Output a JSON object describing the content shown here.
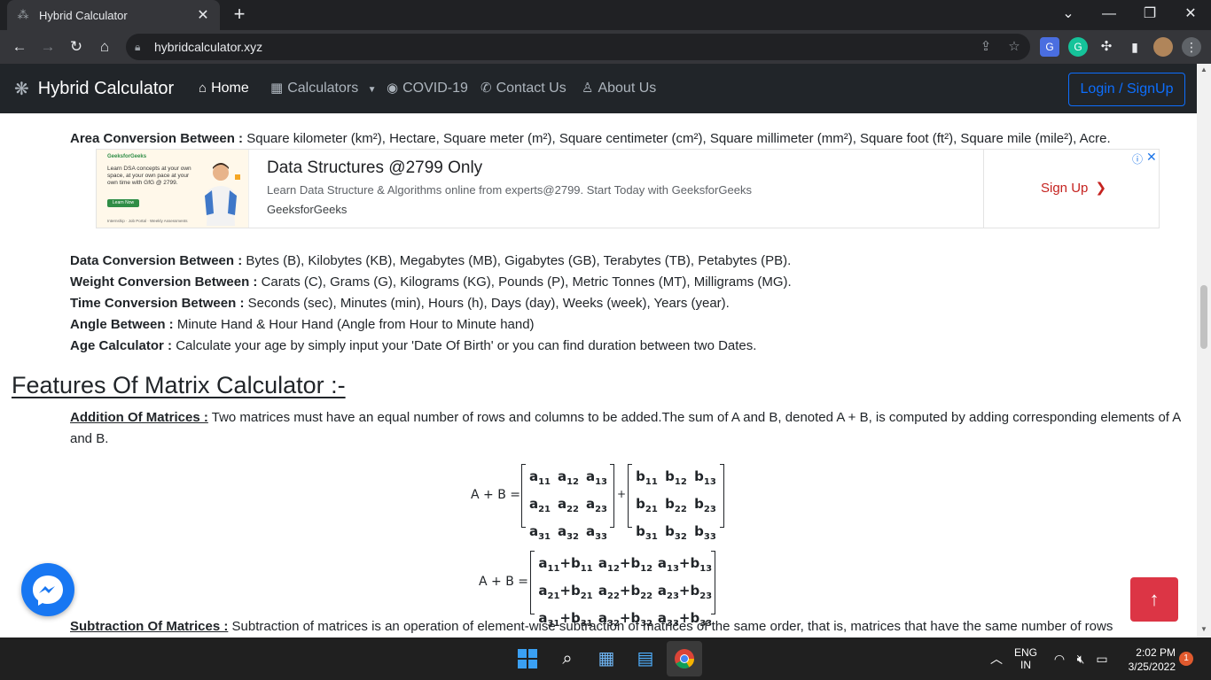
{
  "browser": {
    "tab_title": "Hybrid Calculator",
    "url": "hybridcalculator.xyz"
  },
  "site_nav": {
    "brand": "Hybrid Calculator",
    "links": [
      {
        "label": "Home",
        "icon": "home-icon"
      },
      {
        "label": "Calculators",
        "icon": "calculator-icon"
      },
      {
        "label": "COVID-19",
        "icon": "record-icon"
      },
      {
        "label": "Contact Us",
        "icon": "phone-icon"
      },
      {
        "label": "About Us",
        "icon": "person-icon"
      }
    ],
    "login_button": "Login / SignUp"
  },
  "conversions": {
    "area": {
      "label": "Area Conversion Between :",
      "text": " Square kilometer (km²), Hectare, Square meter (m²), Square centimeter (cm²), Square millimeter (mm²), Square foot (ft²), Square mile (mile²), Acre."
    },
    "data": {
      "label": "Data Conversion Between :",
      "text": " Bytes (B), Kilobytes (KB), Megabytes (MB), Gigabytes (GB), Terabytes (TB), Petabytes (PB)."
    },
    "weight": {
      "label": "Weight Conversion Between :",
      "text": " Carats (C), Grams (G), Kilograms (KG), Pounds (P), Metric Tonnes (MT), Milligrams (MG)."
    },
    "time": {
      "label": "Time Conversion Between :",
      "text": " Seconds (sec), Minutes (min), Hours (h), Days (day), Weeks (week), Years (year)."
    },
    "angle": {
      "label": "Angle Between :",
      "text": " Minute Hand & Hour Hand (Angle from Hour to Minute hand)"
    },
    "age": {
      "label": "Age Calculator :",
      "text": " Calculate your age by simply input your 'Date Of Birth' or you can find duration between two Dates."
    }
  },
  "ad": {
    "image_brand": "GeeksforGeeks",
    "image_text": "Learn DSA concepts at your own space, at your own pace at your own time with GfG @ 2799.",
    "image_button": "Learn Now",
    "image_footer": "Internship · Job Portal · Weekly Assessments",
    "title": "Data Structures @2799 Only",
    "description": "Learn Data Structure & Algorithms online from experts@2799. Start Today with GeeksforGeeks",
    "source": "GeeksforGeeks",
    "cta": "Sign Up"
  },
  "matrix_section": {
    "heading": "Features Of Matrix Calculator :-",
    "addition_label": "Addition Of Matrices :",
    "addition_text": " Two matrices must have an equal number of rows and columns to be added.The sum of A and B, denoted A + B, is computed by adding corresponding elements of A and B.",
    "eq_label": "A + B =",
    "plus": "+",
    "subtraction_label": "Subtraction Of Matrices :",
    "subtraction_text": " Subtraction of matrices is an operation of element-wise subtraction of matrices of the same order, that is, matrices that have the same number of rows"
  },
  "taskbar": {
    "lang": "ENG",
    "region": "IN",
    "time": "2:02 PM",
    "date": "3/25/2022",
    "notifications": "1"
  },
  "colors": {
    "navbar_bg": "#212529",
    "login_border": "#0d6efd",
    "totop_bg": "#dc3545",
    "messenger": "#1877f2"
  }
}
